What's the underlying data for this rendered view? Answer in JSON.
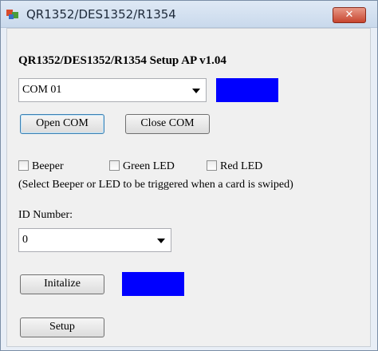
{
  "window": {
    "title": "QR1352/DES1352/R1354",
    "close_label": "✕"
  },
  "app": {
    "heading": "QR1352/DES1352/R1354 Setup AP   v1.04",
    "com_port": {
      "value": "COM 01",
      "status_color": "#0000ff"
    },
    "open_com_label": "Open COM",
    "close_com_label": "Close COM",
    "options": [
      {
        "label": "Beeper",
        "checked": false
      },
      {
        "label": "Green LED",
        "checked": false
      },
      {
        "label": "Red LED",
        "checked": false
      }
    ],
    "hint": "(Select Beeper or LED to be triggered when a card is swiped)",
    "id_label": "ID Number:",
    "id_value": "0",
    "initialize_label": "Initalize",
    "init_status_color": "#0000ff",
    "setup_label": "Setup"
  }
}
